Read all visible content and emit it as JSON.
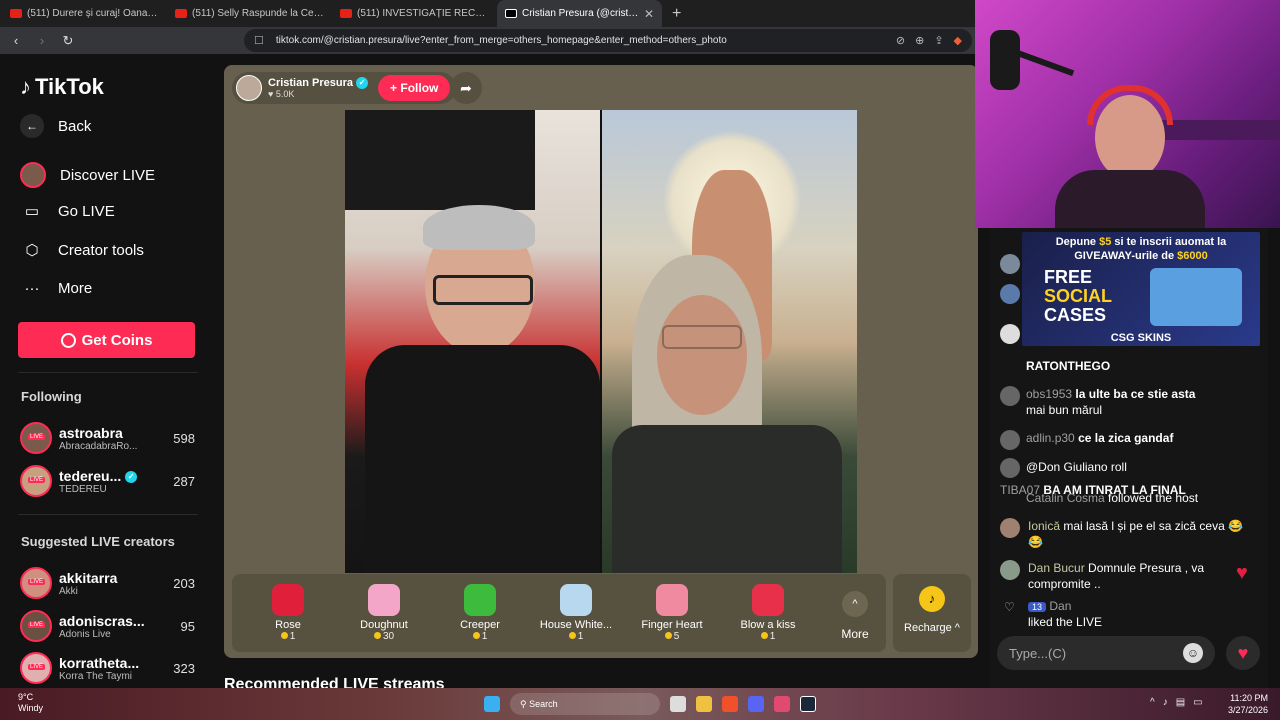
{
  "browser": {
    "tabs": [
      {
        "title": "(511) Durere și curaj! Oana Maria Ro",
        "active": false
      },
      {
        "title": "(511) Selly Raspunde la Cele Mai Cu",
        "active": false
      },
      {
        "title": "(511) INVESTIGAȚIE RECORDER. Și în",
        "active": false
      },
      {
        "title": "Cristian Presura (@cristian.pr",
        "active": true
      }
    ],
    "url": "tiktok.com/@cristian.presura/live?enter_from_merge=others_homepage&enter_method=others_photo"
  },
  "sidebar": {
    "logo": "TikTok",
    "back": "Back",
    "menu": [
      {
        "label": "Discover LIVE",
        "icon": "discover-live-icon"
      },
      {
        "label": "Go LIVE",
        "icon": "camera-icon"
      },
      {
        "label": "Creator tools",
        "icon": "play-icon"
      },
      {
        "label": "More",
        "icon": "dots-icon"
      }
    ],
    "get_coins": "Get Coins",
    "following_title": "Following",
    "following": [
      {
        "name": "astroabra",
        "sub": "AbracadabraRo...",
        "count": "598"
      },
      {
        "name": "tedereu...",
        "sub": "TEDEREU",
        "count": "287"
      }
    ],
    "suggested_title": "Suggested LIVE creators",
    "suggested": [
      {
        "name": "akkitarra",
        "sub": "Akki",
        "count": "203"
      },
      {
        "name": "adoniscras...",
        "sub": "Adonis Live",
        "count": "95"
      },
      {
        "name": "korratheta...",
        "sub": "Korra The Taymi",
        "count": "323"
      }
    ],
    "live_badge": "LIVE"
  },
  "player": {
    "host_name": "Cristian Presura",
    "likes": "5.0K",
    "follow": "+ Follow",
    "gifts": [
      {
        "name": "Rose",
        "price": "1",
        "color": "#e0203a"
      },
      {
        "name": "Doughnut",
        "price": "30",
        "color": "#f3a6c8"
      },
      {
        "name": "Creeper",
        "price": "1",
        "color": "#3dbb3d"
      },
      {
        "name": "House White...",
        "price": "1",
        "color": "#b8d8f0"
      },
      {
        "name": "Finger Heart",
        "price": "5",
        "color": "#f08aa0"
      },
      {
        "name": "Blow a kiss",
        "price": "1",
        "color": "#e8304a"
      }
    ],
    "more": "More",
    "recharge": "Recharge"
  },
  "recommended": "Recommended LIVE streams",
  "chat": {
    "ad_line1a": "Depune ",
    "ad_amount1": "$5",
    "ad_line1b": " si te inscrii auomat la",
    "ad_line2a": "GIVEAWAY-urile de ",
    "ad_amount2": "$6000",
    "ad_free": "FREE",
    "ad_social": "SOCIAL",
    "ad_cases": "CASES",
    "ad_brand": "CSG SKINS",
    "messages": [
      {
        "user": "",
        "text": "RATONTHEGO"
      },
      {
        "user": "obs1953",
        "text": "la ulte ba ce stie asta"
      },
      {
        "user": "",
        "text": "mai bun mărul"
      },
      {
        "user": "adlin.p30",
        "text": "ce la zica gandaf"
      },
      {
        "user": "",
        "text": "@Don Giuliano roll"
      },
      {
        "user": "TIBA07",
        "text": "BA AM ITNRAT LA FINAL"
      },
      {
        "user": "Catalin Cosma",
        "text": "followed the host"
      },
      {
        "user": "Ionică",
        "text": "mai lasă l și pe el sa zică ceva 😂 😂"
      },
      {
        "user": "Dan Bucur",
        "text": "Domnule Presura , va compromite .."
      },
      {
        "user": "Dan",
        "text": "liked the LIVE",
        "level": "13"
      }
    ],
    "input_placeholder": "Type...(C)"
  },
  "taskbar": {
    "temp": "9°C",
    "weather": "Windy",
    "search": "Search",
    "time": "11:20 PM",
    "date": "3/27/2026"
  }
}
